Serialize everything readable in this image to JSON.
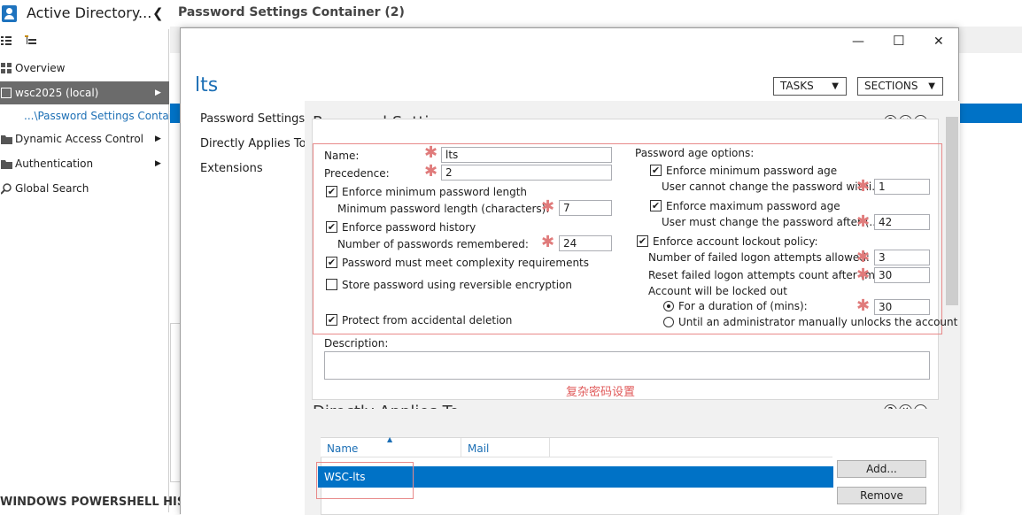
{
  "nav": {
    "title": "Active Directory...",
    "collapse": "❮",
    "items": [
      {
        "label": "Overview"
      },
      {
        "label": "wsc2025 (local)"
      },
      {
        "label": "...\\Password Settings Contai..."
      },
      {
        "label": "Dynamic Access Control"
      },
      {
        "label": "Authentication"
      },
      {
        "label": "Global Search"
      }
    ]
  },
  "main": {
    "title": "Password Settings Container  (2)",
    "powershell_history": "WINDOWS POWERSHELL HISTO"
  },
  "dialog": {
    "window_buttons": {
      "minimize": "—",
      "maximize": "☐",
      "close": "✕"
    },
    "name": "lts",
    "tasks": "TASKS",
    "sections": "SECTIONS",
    "nav": [
      "Password Settings",
      "Directly Applies To",
      "Extensions"
    ],
    "password_settings": {
      "title": "Password Settings",
      "name_label": "Name:",
      "name_value": "lts",
      "precedence_label": "Precedence:",
      "precedence_value": "2",
      "enforce_min_len": "Enforce minimum password length",
      "min_len_label": "Minimum password length (characters):",
      "min_len_value": "7",
      "enforce_history": "Enforce password history",
      "history_label": "Number of passwords remembered:",
      "history_value": "24",
      "complexity": "Password must meet complexity requirements",
      "reversible": "Store password using reversible encryption",
      "protect": "Protect from accidental deletion",
      "age_options": "Password age options:",
      "enforce_min_age": "Enforce minimum password age",
      "min_age_label": "User cannot change the password withi...",
      "min_age_value": "1",
      "enforce_max_age": "Enforce maximum password age",
      "max_age_label": "User must change the password after (...",
      "max_age_value": "42",
      "lockout_policy": "Enforce account lockout policy:",
      "failed_label": "Number of failed logon attempts allowed:",
      "failed_value": "3",
      "reset_label": "Reset failed logon attempts count after (m...",
      "reset_value": "30",
      "locked_out": "Account will be locked out",
      "duration_label": "For a duration of (mins):",
      "duration_value": "30",
      "until_admin": "Until an administrator manually unlocks the account",
      "description_label": "Description:",
      "annotation": "复杂密码设置"
    },
    "directly_applies": {
      "title": "Directly Applies To",
      "col_name": "Name",
      "col_mail": "Mail",
      "rows": [
        {
          "name": "WSC-lts"
        }
      ],
      "add": "Add...",
      "remove": "Remove"
    }
  }
}
